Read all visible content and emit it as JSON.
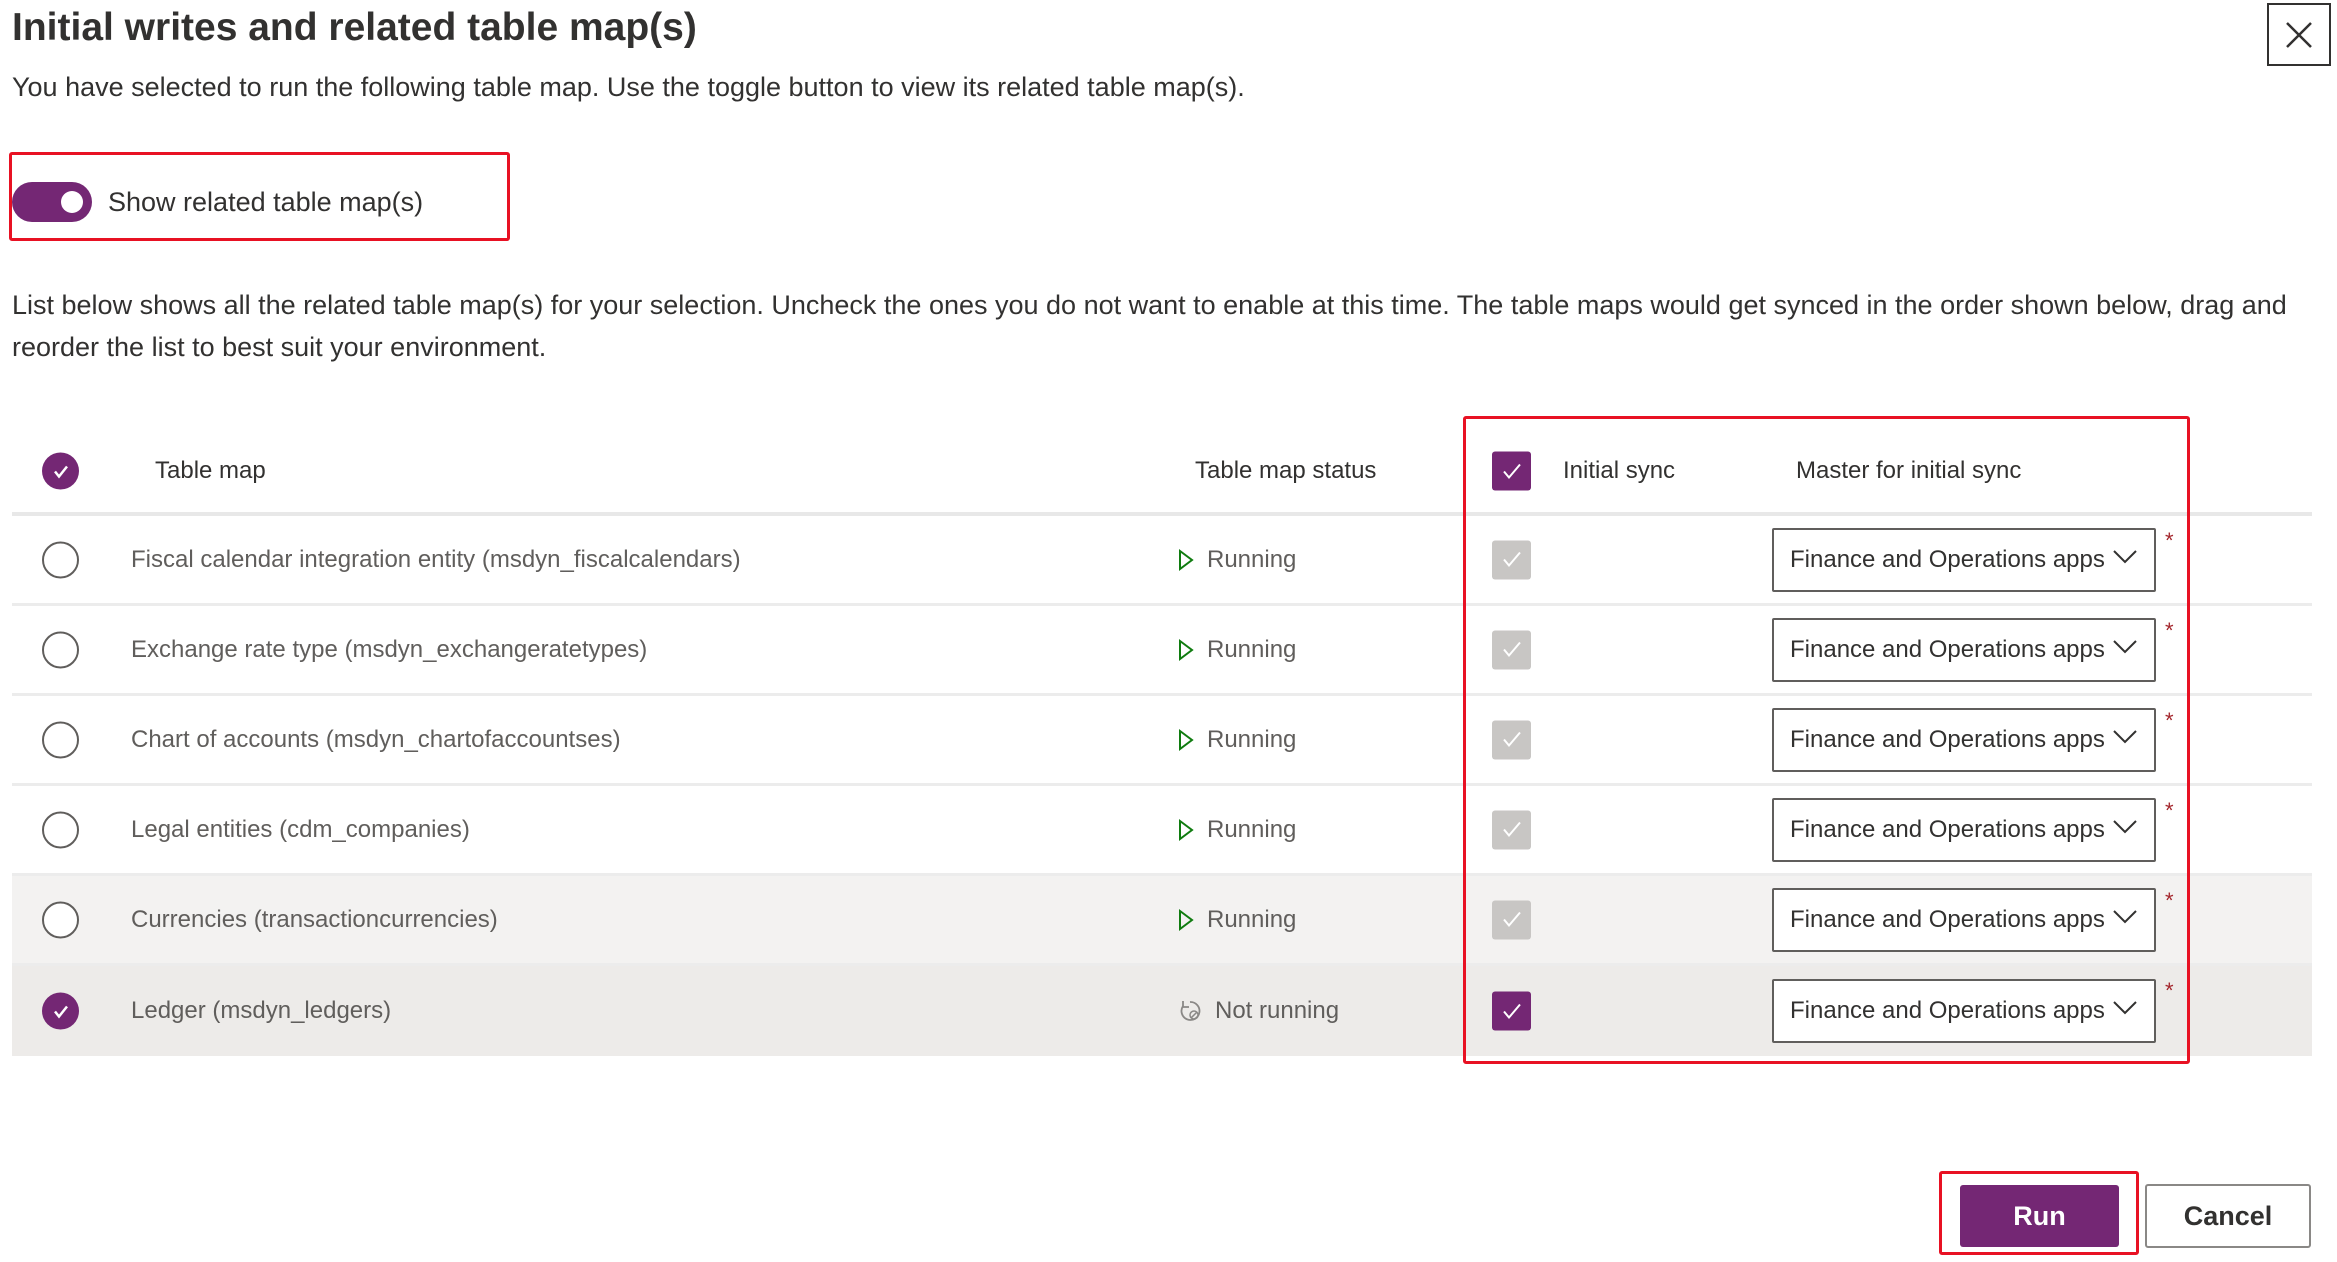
{
  "dialog": {
    "title": "Initial writes and related table map(s)",
    "subtitle": "You have selected to run the following table map. Use the toggle button to view its related table map(s).",
    "close_icon": "close-icon",
    "toggle": {
      "label": "Show related table map(s)",
      "on": true
    },
    "description": "List below shows all the related table map(s) for your selection. Uncheck the ones you do not want to enable at this time. The table maps would get synced in the order shown below, drag and reorder the list to best suit your environment."
  },
  "table": {
    "headers": {
      "table_map": "Table map",
      "status": "Table map status",
      "initial_sync": "Initial sync",
      "master": "Master for initial sync"
    },
    "rows": [
      {
        "name": "Fiscal calendar integration entity (msdyn_fiscalcalendars)",
        "status": "Running",
        "master": "Finance and Operations apps",
        "required": "*"
      },
      {
        "name": "Exchange rate type (msdyn_exchangeratetypes)",
        "status": "Running",
        "master": "Finance and Operations apps",
        "required": "*"
      },
      {
        "name": "Chart of accounts (msdyn_chartofaccountses)",
        "status": "Running",
        "master": "Finance and Operations apps",
        "required": "*"
      },
      {
        "name": "Legal entities (cdm_companies)",
        "status": "Running",
        "master": "Finance and Operations apps",
        "required": "*"
      },
      {
        "name": "Currencies (transactioncurrencies)",
        "status": "Running",
        "master": "Finance and Operations apps",
        "required": "*"
      },
      {
        "name": "Ledger (msdyn_ledgers)",
        "status": "Not running",
        "master": "Finance and Operations apps",
        "required": "*"
      }
    ]
  },
  "buttons": {
    "run": "Run",
    "cancel": "Cancel"
  },
  "colors": {
    "accent": "#742774",
    "running": "#107c10",
    "highlight": "#e81123"
  }
}
